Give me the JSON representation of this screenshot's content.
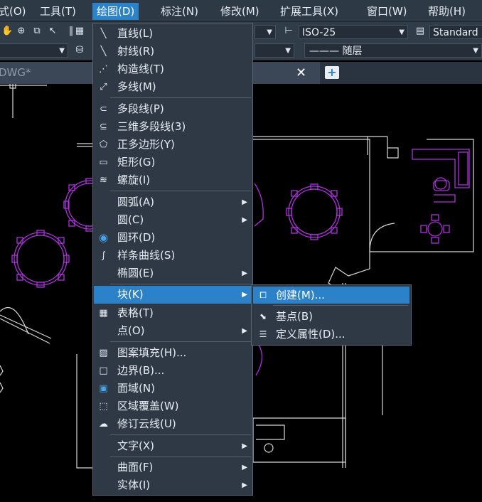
{
  "menubar": {
    "items": [
      {
        "label": "式(O)"
      },
      {
        "label": "工具(T)"
      },
      {
        "label": "绘图(D)"
      },
      {
        "label": "标注(N)"
      },
      {
        "label": "修改(M)"
      },
      {
        "label": "扩展工具(X)"
      },
      {
        "label": "窗口(W)"
      },
      {
        "label": "帮助(H)"
      }
    ]
  },
  "toolbar": {
    "dimstyle_value": "ISO-25",
    "textstyle_value": "Standard",
    "linetype_value": "——— 随层"
  },
  "tab": {
    "title": "DWG*",
    "close_glyph": "✕",
    "new_glyph": "+"
  },
  "draw_menu": {
    "items": [
      {
        "label": "直线(L)"
      },
      {
        "label": "射线(R)"
      },
      {
        "label": "构造线(T)"
      },
      {
        "label": "多线(M)"
      },
      {
        "label": "多段线(P)"
      },
      {
        "label": "三维多段线(3)"
      },
      {
        "label": "正多边形(Y)"
      },
      {
        "label": "矩形(G)"
      },
      {
        "label": "螺旋(I)"
      },
      {
        "label": "圆弧(A)"
      },
      {
        "label": "圆(C)"
      },
      {
        "label": "圆环(D)"
      },
      {
        "label": "样条曲线(S)"
      },
      {
        "label": "椭圆(E)"
      },
      {
        "label": "块(K)"
      },
      {
        "label": "表格(T)"
      },
      {
        "label": "点(O)"
      },
      {
        "label": "图案填充(H)..."
      },
      {
        "label": "边界(B)..."
      },
      {
        "label": "面域(N)"
      },
      {
        "label": "区域覆盖(W)"
      },
      {
        "label": "修订云线(U)"
      },
      {
        "label": "文字(X)"
      },
      {
        "label": "曲面(F)"
      },
      {
        "label": "实体(I)"
      }
    ]
  },
  "block_submenu": {
    "items": [
      {
        "label": "创建(M)..."
      },
      {
        "label": "基点(B)"
      },
      {
        "label": "定义属性(D)..."
      }
    ]
  },
  "colors": {
    "accent": "#2b82c9",
    "menu_bg": "#2f3946",
    "drawing_purple": "#b030e0",
    "drawing_white": "#d8d8d8"
  }
}
